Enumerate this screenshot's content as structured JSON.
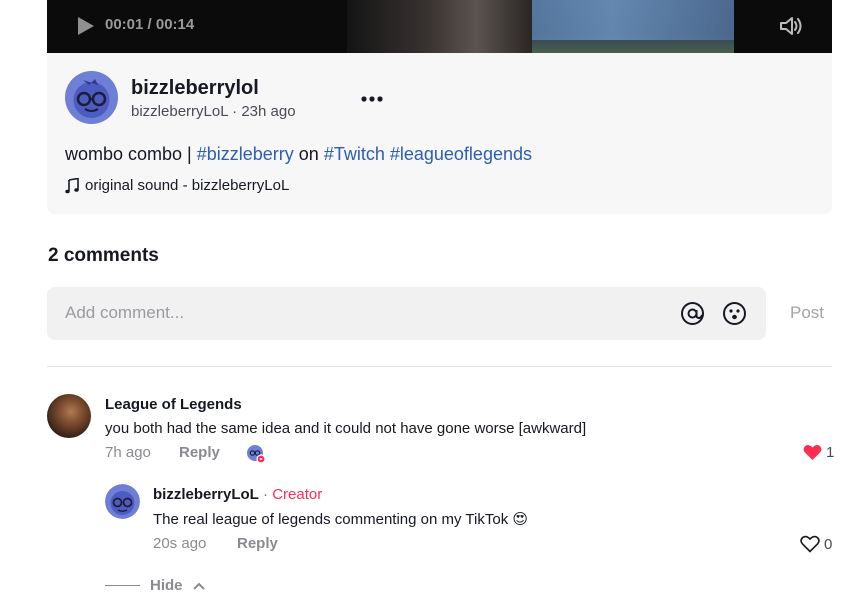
{
  "video": {
    "time": "00:01 / 00:14",
    "icons": {
      "play": "play-icon",
      "volume": "volume-icon"
    }
  },
  "post": {
    "author_display": "bizzleberrylol",
    "author_handle": "bizzleberryLoL",
    "separator": " · ",
    "age": "23h ago",
    "description_prefix": "wombo combo | ",
    "tag1": "#bizzleberry",
    "description_mid": " on ",
    "tag2": "#Twitch",
    "tag3": "#leagueoflegends",
    "sound": "original sound - bizzleberryLoL"
  },
  "comments": {
    "count_label": "2 comments",
    "input_placeholder": "Add comment...",
    "post_label": "Post",
    "items": [
      {
        "author": "League of Legends",
        "text": "you both had the same idea and it could not have gone worse [awkward]",
        "age": "7h ago",
        "reply_label": "Reply",
        "likes": "1",
        "liked": true,
        "creator_liked": true
      },
      {
        "author": "bizzleberryLoL",
        "creator_label": " · Creator",
        "text": "The real league of legends commenting on my TikTok 😍",
        "age": "20s ago",
        "reply_label": "Reply",
        "likes": "0",
        "liked": false
      }
    ],
    "hide_label": "Hide"
  },
  "colors": {
    "accent": "#fe2c55",
    "hashtag": "#2b5db9",
    "text": "#161823",
    "muted": "#8a8b91"
  }
}
